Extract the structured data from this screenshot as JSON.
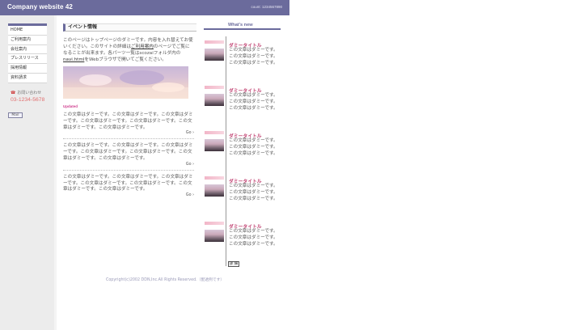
{
  "header": {
    "title": "Company website 42",
    "count": "count: 1234567890"
  },
  "nav": {
    "items": [
      {
        "label": "HOME"
      },
      {
        "label": "ご利用案内"
      },
      {
        "label": "会社案内"
      },
      {
        "label": "プレスリリース"
      },
      {
        "label": "採用情報"
      },
      {
        "label": "資料請求"
      }
    ]
  },
  "contact": {
    "symbol": "☎",
    "label": "お問い合わせ",
    "phone": "03-1234-5678",
    "mail_label": "Mail"
  },
  "main": {
    "section_title": "イベント情報",
    "intro": {
      "part1": "このページはトップページのダミーです。内容を入れ替えてお使いください。このサイトの詳細は",
      "link1": "ご利用案内",
      "part2": "のページでご覧になることが出来ます。各パーツ一覧はscozaiフォルダ内の",
      "link2": "navi.html",
      "part3": "をWebブラウザで開いてご覧ください。"
    },
    "updated_label": "Updated",
    "entries": [
      {
        "text": "この文章はダミーです。この文章はダミーです。この文章はダミーです。この文章はダミーです。この文章はダミーです。この文章はダミーです。この文章はダミーです。",
        "go": "Go ›"
      },
      {
        "text": "この文章はダミーです。この文章はダミーです。この文章はダミーです。この文章はダミーです。この文章はダミーです。この文章はダミーです。この文章はダミーです。",
        "go": "Go ›"
      },
      {
        "text": "この文章はダミーです。この文章はダミーです。この文章はダミーです。この文章はダミーです。この文章はダミーです。この文章はダミーです。この文章はダミーです。",
        "go": "Go ›"
      }
    ]
  },
  "whatsnew": {
    "title": "What's new",
    "items": [
      {
        "title": "ダミータイトル",
        "body": "この文章はダミーです。この文章はダミーです。この文章はダミーです。"
      },
      {
        "title": "ダミータイトル",
        "body": "この文章はダミーです。この文章はダミーです。この文章はダミーです。"
      },
      {
        "title": "ダミータイトル",
        "body": "この文章はダミーです。この文章はダミーです。この文章はダミーです。"
      },
      {
        "title": "ダミータイトル",
        "body": "この文章はダミーです。この文章はダミーです。この文章はダミーです。"
      },
      {
        "title": "ダミータイトル",
        "body": "この文章はダミーです。この文章はダミーです。この文章はダミーです。"
      }
    ],
    "detail_label": "詳 細"
  },
  "footer": {
    "copyright": "Copyright(c)2002 DDN,Inc.All Rights Reserved.（配透例です）"
  },
  "colors": {
    "header": "#6b6b9c",
    "accent_pink": "#c04070",
    "phone": "#e07070"
  }
}
